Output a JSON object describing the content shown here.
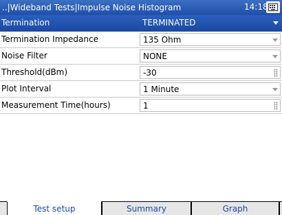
{
  "header": {
    "title": "..|Wideband Tests|Impulse Noise Histogram",
    "time": "14:18"
  },
  "rows": [
    {
      "label": "Termination",
      "value": "TERMINATED",
      "control": "dropdown",
      "selected": true
    },
    {
      "label": "Termination Impedance",
      "value": "135 Ohm",
      "control": "dropdown"
    },
    {
      "label": "Noise Filter",
      "value": "NONE",
      "control": "dropdown"
    },
    {
      "label": "Threshold(dBm)",
      "value": "-30",
      "control": "numeric"
    },
    {
      "label": "Plot Interval",
      "value": "1 Minute",
      "control": "dropdown"
    },
    {
      "label": "Measurement Time(hours)",
      "value": "1",
      "control": "numeric"
    }
  ],
  "tabs": [
    {
      "label": "Test setup",
      "active": true
    },
    {
      "label": "Summary"
    },
    {
      "label": "Graph"
    }
  ],
  "colors": {
    "titlebar": "#1f4fa8",
    "selection": "#2c5fbf",
    "tab_text": "#1a4aa2"
  },
  "icons": {
    "keyboard": "keyboard-icon",
    "dropdown": "chevron-down-icon",
    "numeric": "numeric-keypad-icon"
  }
}
